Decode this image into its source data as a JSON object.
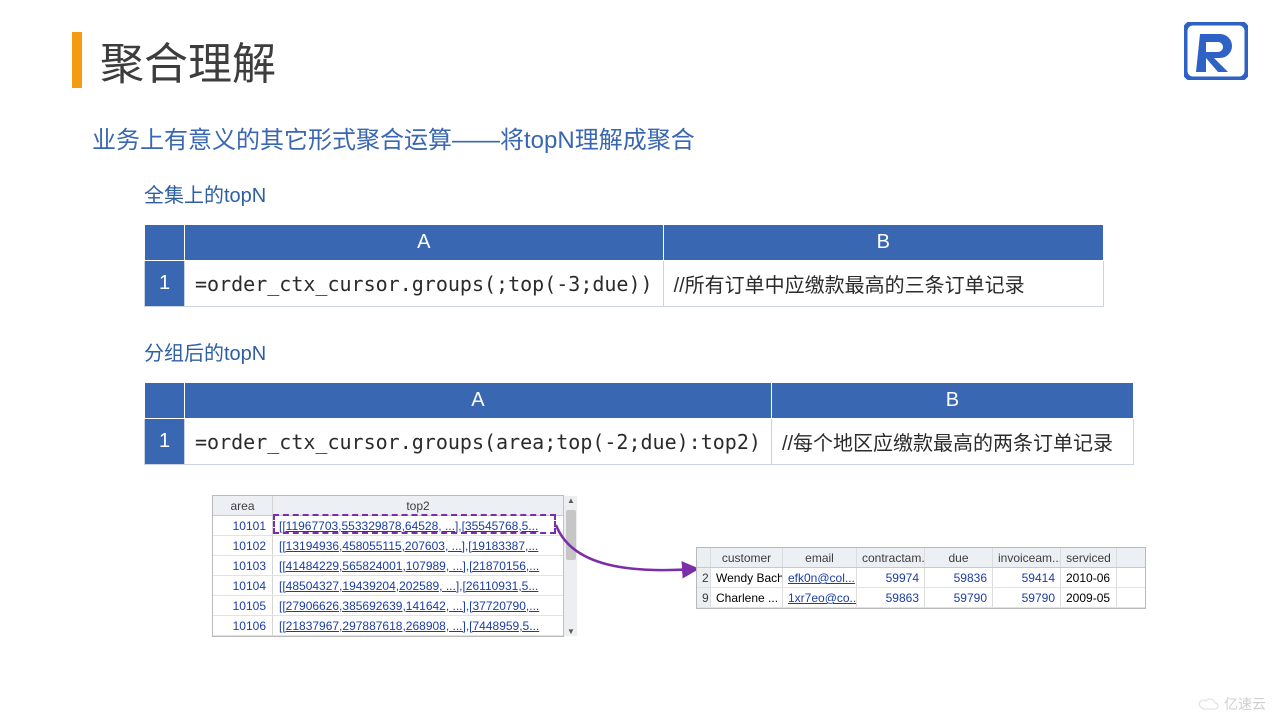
{
  "title": "聚合理解",
  "subtitle": "业务上有意义的其它形式聚合运算——将topN理解成聚合",
  "sections": {
    "s1_label": "全集上的topN",
    "s2_label": "分组后的topN"
  },
  "table1": {
    "hA": "A",
    "hB": "B",
    "r1": "1",
    "a1": "=order_ctx_cursor.groups(;top(-3;due))",
    "b1": "//所有订单中应缴款最高的三条订单记录"
  },
  "table2": {
    "hA": "A",
    "hB": "B",
    "r1": "1",
    "a1": "=order_ctx_cursor.groups(area;top(-2;due):top2)",
    "b1": "//每个地区应缴款最高的两条订单记录"
  },
  "left_grid": {
    "h_area": "area",
    "h_top2": "top2",
    "rows": [
      {
        "area": "10101",
        "top2": "[[11967703,553329878,64528, ...],[35545768,5..."
      },
      {
        "area": "10102",
        "top2": "[[13194936,458055115,207603, ...],[19183387,..."
      },
      {
        "area": "10103",
        "top2": "[[41484229,565824001,107989, ...],[21870156,..."
      },
      {
        "area": "10104",
        "top2": "[[48504327,19439204,202589, ...],[26110931,5..."
      },
      {
        "area": "10105",
        "top2": "[[27906626,385692639,141642, ...],[37720790,..."
      },
      {
        "area": "10106",
        "top2": "[[21837967,297887618,268908, ...],[7448959,5..."
      }
    ]
  },
  "right_grid": {
    "h_cust": "customer",
    "h_email": "email",
    "h_c1": "contractam...",
    "h_c2": "due",
    "h_c3": "invoiceam...",
    "h_c4": "serviced",
    "rows": [
      {
        "idx": "2",
        "cust": "Wendy Bach",
        "email": "efk0n@col...",
        "c1": "59974",
        "c2": "59836",
        "c3": "59414",
        "c4": "2010-06"
      },
      {
        "idx": "9",
        "cust": "Charlene ...",
        "email": "1xr7eo@co...",
        "c1": "59863",
        "c2": "59790",
        "c3": "59790",
        "c4": "2009-05"
      }
    ]
  },
  "watermark": "亿速云"
}
